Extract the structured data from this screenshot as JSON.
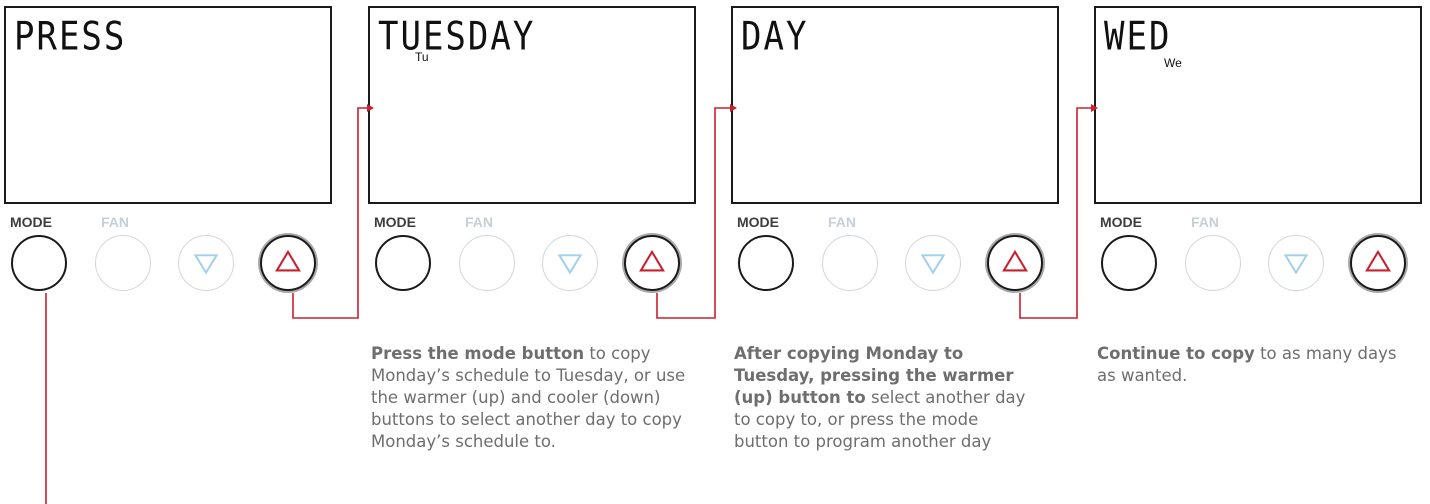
{
  "panels": [
    {
      "display": "PRESS",
      "day_sub": ""
    },
    {
      "display": "TUESDAY",
      "day_sub": "Tu"
    },
    {
      "display": "DAY",
      "day_sub": ""
    },
    {
      "display": "WED",
      "day_sub": "We"
    }
  ],
  "buttons": {
    "mode_label": "MODE",
    "fan_label": "FAN"
  },
  "descriptions": [
    {
      "bold": "Press the mode button",
      "rest": " to copy Monday’s schedule to Tuesday, or use the warmer (up) and cooler (down) buttons to select another day to copy Monday’s schedule to."
    },
    {
      "bold": "After copying Monday to Tuesday, pressing the warmer (up) button to",
      "rest": " select another day to copy to, or press the mode button to program another day"
    },
    {
      "bold": "Continue to copy",
      "rest": " to as many days as wanted."
    }
  ],
  "colors": {
    "accent_red": "#c8202f",
    "screen_border": "#1a1a1a",
    "inactive": "#c6cfd6",
    "text_gray": "#6e6e6e"
  }
}
